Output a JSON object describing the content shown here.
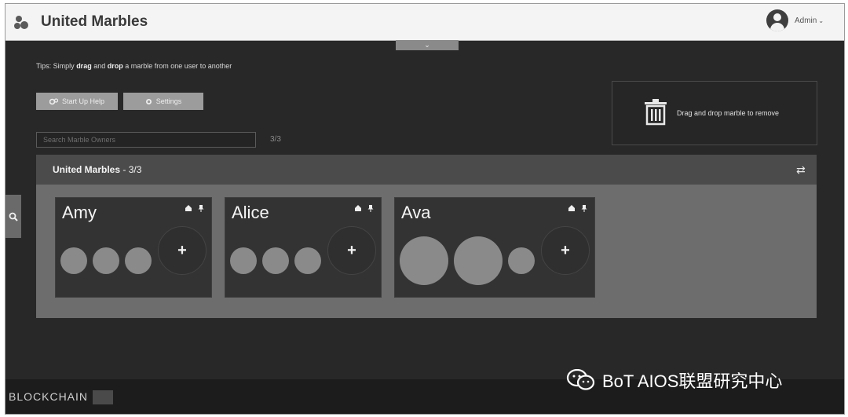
{
  "header": {
    "title": "United Marbles",
    "user_menu": "Admin",
    "logo_icon": "marbles-logo-icon"
  },
  "tips": {
    "prefix": "Tips: Simply ",
    "drag": "drag",
    "middle": " and ",
    "drop": "drop",
    "suffix": " a marble from one user to another"
  },
  "toolbar": {
    "help_label": "Start Up Help",
    "settings_label": "Settings"
  },
  "search": {
    "placeholder": "Search Marble Owners",
    "count": "3/3"
  },
  "trash": {
    "label": "Drag and drop marble to remove"
  },
  "group": {
    "name": "United Marbles",
    "separator": " - ",
    "count": "3/3"
  },
  "owners": [
    {
      "name": "Amy",
      "marbles": [
        "small",
        "small",
        "small"
      ]
    },
    {
      "name": "Alice",
      "marbles": [
        "small",
        "small",
        "small"
      ]
    },
    {
      "name": "Ava",
      "marbles": [
        "large",
        "large",
        "small"
      ]
    }
  ],
  "colors": {
    "marble": "#8a8a8a",
    "background": "#282828",
    "panel": "#6d6d6d"
  },
  "footer": {
    "brand": "BLOCKCHAIN"
  },
  "watermark": {
    "text": "BoT AIOS联盟研究中心"
  }
}
